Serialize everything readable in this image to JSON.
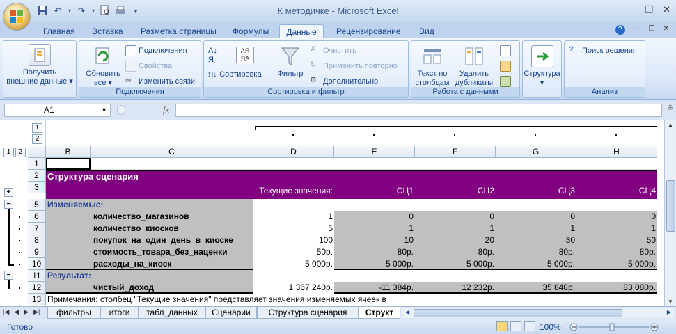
{
  "window": {
    "doc_title": "К методичке",
    "separator": " - ",
    "app_name": "Microsoft Excel"
  },
  "tabs": [
    "Главная",
    "Вставка",
    "Разметка страницы",
    "Формулы",
    "Данные",
    "Рецензирование",
    "Вид"
  ],
  "active_tab": "Данные",
  "ribbon": {
    "get_external": {
      "line1": "Получить",
      "line2": "внешние данные"
    },
    "connections_group": {
      "label": "Подключения",
      "refresh_line1": "Обновить",
      "refresh_line2": "все",
      "connections": "Подключения",
      "properties": "Свойства",
      "edit_links": "Изменить связи"
    },
    "sort_filter_group": {
      "label": "Сортировка и фильтр",
      "sort": "Сортировка",
      "filter": "Фильтр",
      "clear": "Очистить",
      "reapply": "Применить повторно",
      "advanced": "Дополнительно"
    },
    "data_tools_group": {
      "label": "Работа с данными",
      "text_to_columns_line1": "Текст по",
      "text_to_columns_line2": "столбцам",
      "remove_dup_line1": "Удалить",
      "remove_dup_line2": "дубликаты"
    },
    "outline_group": {
      "structure": "Структура"
    },
    "analysis_group": {
      "label": "Анализ",
      "solver": "Поиск решения"
    }
  },
  "formula_bar": {
    "name_box": "A1",
    "fx": "fx",
    "content": ""
  },
  "outline": {
    "col_levels": [
      "1",
      "2"
    ],
    "row_levels": [
      "1",
      "2"
    ]
  },
  "columns": [
    "B",
    "C",
    "D",
    "E",
    "F",
    "G",
    "H"
  ],
  "rows": [
    {
      "num": "1",
      "cells": {}
    },
    {
      "num": "2",
      "cells": {
        "B": "Структура сценария"
      }
    },
    {
      "num": "3",
      "cells": {
        "D": "Текущие значения:",
        "E": "СЦ1",
        "F": "СЦ2",
        "G": "СЦ3",
        "H": "СЦ4"
      }
    },
    {
      "num": "5",
      "cells": {
        "B": "Изменяемые:"
      }
    },
    {
      "num": "6",
      "cells": {
        "C": "количество_магазинов",
        "D": "1",
        "E": "0",
        "F": "0",
        "G": "0",
        "H": "0"
      }
    },
    {
      "num": "7",
      "cells": {
        "C": "количество_киосков",
        "D": "5",
        "E": "1",
        "F": "1",
        "G": "1",
        "H": "1"
      }
    },
    {
      "num": "8",
      "cells": {
        "C": "покупок_на_один_день_в_киоске",
        "D": "100",
        "E": "10",
        "F": "20",
        "G": "30",
        "H": "50"
      }
    },
    {
      "num": "9",
      "cells": {
        "C": "стоимость_товара_без_наценки",
        "D": "50р.",
        "E": "80р.",
        "F": "80р.",
        "G": "80р.",
        "H": "80р."
      }
    },
    {
      "num": "10",
      "cells": {
        "C": "расходы_на_киоск",
        "D": "5 000р.",
        "E": "5 000р.",
        "F": "5 000р.",
        "G": "5 000р.",
        "H": "5 000р."
      }
    },
    {
      "num": "11",
      "cells": {
        "B": "Результат:"
      }
    },
    {
      "num": "12",
      "cells": {
        "C": "чистый_доход",
        "D": "1 367 240р.",
        "E": "-11 384р.",
        "F": "12 232р.",
        "G": "35 848р.",
        "H": "83 080р."
      }
    },
    {
      "num": "13",
      "cells": {
        "B": "Примечания: столбец \"Текущие значения\" представляет значения изменяемых ячеек в"
      }
    }
  ],
  "sheet_tabs": [
    "фильтры",
    "итоги",
    "табл_данных",
    "Сценарии",
    "Структура сценария",
    "Структ"
  ],
  "active_sheet": "Структ",
  "status": {
    "ready": "Готово",
    "zoom": "100%"
  },
  "colors": {
    "header_purple": "#800080",
    "gray_fill": "#c0c0c0",
    "label_blue": "#1f3d94"
  }
}
